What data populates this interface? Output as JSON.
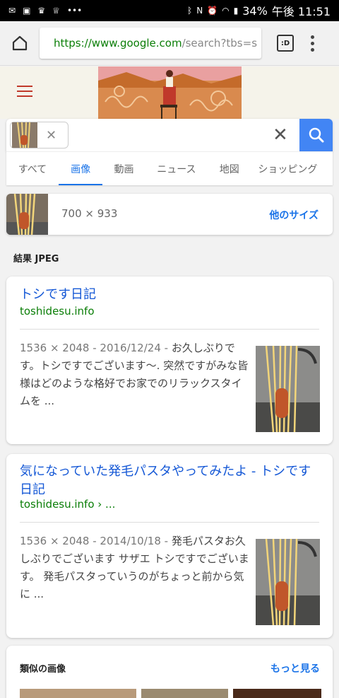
{
  "status_bar": {
    "battery": "34%",
    "time": "午後 11:51",
    "icons": [
      "message-icon",
      "image-icon",
      "hat-icon",
      "crown-icon",
      "more-dots-icon",
      "bluetooth-icon",
      "nfc-icon",
      "alarm-icon",
      "wifi-icon",
      "signal-icon"
    ]
  },
  "browser": {
    "url_domain": "https://www.google.com",
    "url_path": "/search?tbs=s",
    "tabs_icon_label": ":D"
  },
  "search": {
    "tabs": [
      "すべて",
      "画像",
      "動画",
      "ニュース",
      "地図",
      "ショッピング"
    ],
    "active_tab": "画像"
  },
  "image_info": {
    "size": "700 × 933",
    "other_sizes_link": "他のサイズ"
  },
  "result_label": "結果 JPEG",
  "results": [
    {
      "title": "トシです日記",
      "url": "toshidesu.info",
      "meta": "1536 × 2048 - 2016/12/24 - ",
      "snippet": "お久しぶりです。トシですでございます〜. 突然ですがみな皆様はどのような格好でお家でのリラックスタイムを ..."
    },
    {
      "title": "気になっていた発毛パスタやってみたよ - トシです日記",
      "url": "toshidesu.info › ...",
      "meta": "1536 × 2048 - 2014/10/18 - ",
      "snippet": "発毛パスタお久しぶりでございます サザエ トシですでございます。 発毛パスタっていうのがちょっと前から気に ..."
    }
  ],
  "similar": {
    "title": "類似の画像",
    "more_link": "もっと見る"
  },
  "colors": {
    "link_blue": "#1a73e8",
    "url_green": "#0a7e07",
    "search_button": "#4285f4",
    "hamburger_red": "#c0392b"
  }
}
